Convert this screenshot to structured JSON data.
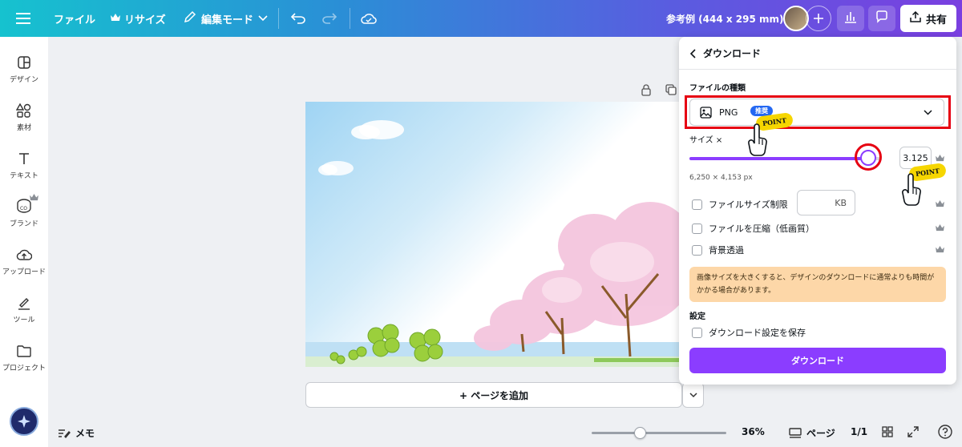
{
  "topbar": {
    "file_label": "ファイル",
    "resize_label": "リサイズ",
    "edit_mode_label": "編集モード",
    "doc_title": "参考例 (444 x 295 mm)",
    "share_label": "共有"
  },
  "sidebar": {
    "items": [
      {
        "label": "デザイン"
      },
      {
        "label": "素材"
      },
      {
        "label": "テキスト"
      },
      {
        "label": "ブランド"
      },
      {
        "label": "アップロード"
      },
      {
        "label": "ツール"
      },
      {
        "label": "プロジェクト"
      }
    ]
  },
  "canvas": {
    "add_page_label": "+ ページを追加"
  },
  "bottombar": {
    "memo_label": "メモ",
    "zoom_level": "36%",
    "zoom_fraction": 0.36,
    "pages_label": "ページ",
    "page_counter": "1/1"
  },
  "download_panel": {
    "title": "ダウンロード",
    "file_type_label": "ファイルの種類",
    "file_type_value": "PNG",
    "recommended_badge": "推奨",
    "point_tag": "POINT",
    "size_label": "サイズ ×",
    "size_value": "3.125",
    "size_fraction": 0.93,
    "pixel_dimensions": "6,250 × 4,153 px",
    "file_size_limit_label": "ファイルサイズ制限",
    "kb_unit": "KB",
    "compress_label": "ファイルを圧縮（低画質）",
    "transparent_bg_label": "背景透過",
    "notice_text": "画像サイズを大きくすると、デザインのダウンロードに通常よりも時間がかかる場合があります。",
    "settings_label": "設定",
    "save_settings_label": "ダウンロード設定を保存",
    "download_button": "ダウンロード"
  },
  "colors": {
    "accent": "#8b3dff",
    "highlight": "#e60012",
    "notice_bg": "#fdd7a8",
    "point_yellow": "#f6d600"
  }
}
